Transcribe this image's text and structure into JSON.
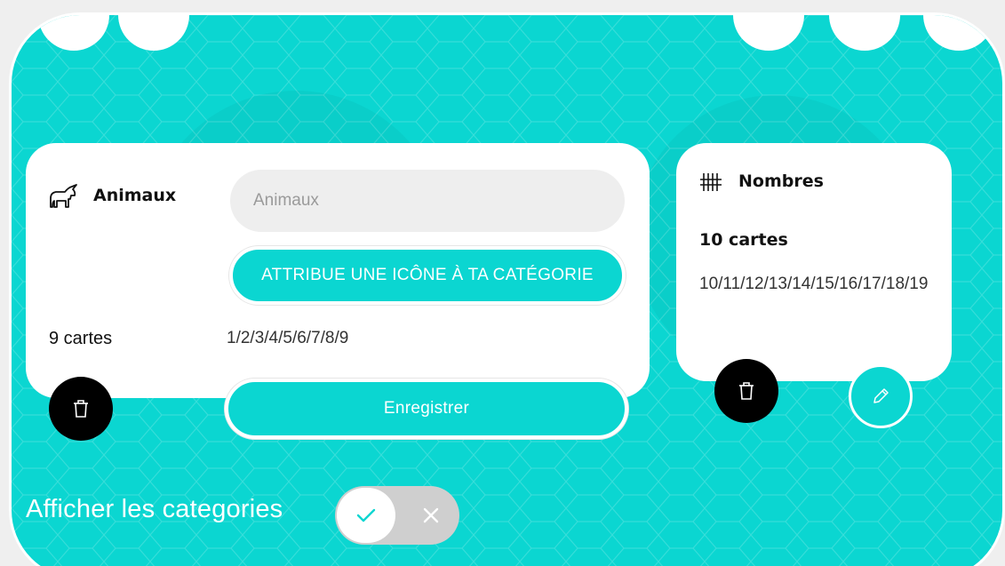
{
  "colors": {
    "accent": "#0bd6d1",
    "background": "#efefef",
    "card": "#ffffff",
    "delete": "#000000"
  },
  "categories": [
    {
      "icon": "unicorn-icon",
      "title": "Animaux",
      "name_input_value": "Animaux",
      "assign_icon_label": "ATTRIBUE UNE ICÔNE À TA CATÉGORIE",
      "count": "9 cartes",
      "cards": "1/2/3/4/5/6/7/8/9",
      "save_label": "Enregistrer"
    },
    {
      "icon": "tally-marks-icon",
      "title": "Nombres",
      "count": "10 cartes",
      "cards": "10/11/12/13/14/15/16/17/18/19"
    }
  ],
  "toggle": {
    "label": "Afficher les categories",
    "checked": true
  }
}
